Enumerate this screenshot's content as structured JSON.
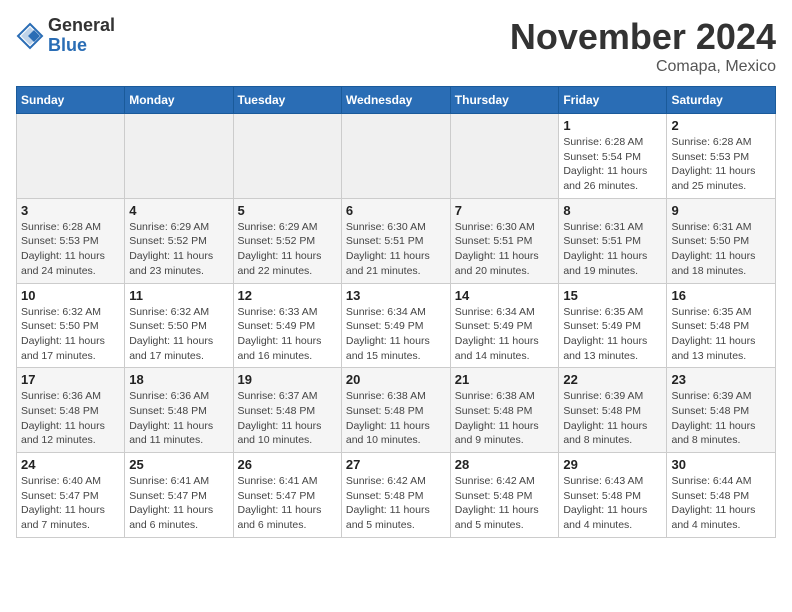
{
  "header": {
    "logo": {
      "line1": "General",
      "line2": "Blue"
    },
    "title": "November 2024",
    "location": "Comapa, Mexico"
  },
  "weekdays": [
    "Sunday",
    "Monday",
    "Tuesday",
    "Wednesday",
    "Thursday",
    "Friday",
    "Saturday"
  ],
  "weeks": [
    [
      {
        "day": "",
        "info": ""
      },
      {
        "day": "",
        "info": ""
      },
      {
        "day": "",
        "info": ""
      },
      {
        "day": "",
        "info": ""
      },
      {
        "day": "",
        "info": ""
      },
      {
        "day": "1",
        "info": "Sunrise: 6:28 AM\nSunset: 5:54 PM\nDaylight: 11 hours\nand 26 minutes."
      },
      {
        "day": "2",
        "info": "Sunrise: 6:28 AM\nSunset: 5:53 PM\nDaylight: 11 hours\nand 25 minutes."
      }
    ],
    [
      {
        "day": "3",
        "info": "Sunrise: 6:28 AM\nSunset: 5:53 PM\nDaylight: 11 hours\nand 24 minutes."
      },
      {
        "day": "4",
        "info": "Sunrise: 6:29 AM\nSunset: 5:52 PM\nDaylight: 11 hours\nand 23 minutes."
      },
      {
        "day": "5",
        "info": "Sunrise: 6:29 AM\nSunset: 5:52 PM\nDaylight: 11 hours\nand 22 minutes."
      },
      {
        "day": "6",
        "info": "Sunrise: 6:30 AM\nSunset: 5:51 PM\nDaylight: 11 hours\nand 21 minutes."
      },
      {
        "day": "7",
        "info": "Sunrise: 6:30 AM\nSunset: 5:51 PM\nDaylight: 11 hours\nand 20 minutes."
      },
      {
        "day": "8",
        "info": "Sunrise: 6:31 AM\nSunset: 5:51 PM\nDaylight: 11 hours\nand 19 minutes."
      },
      {
        "day": "9",
        "info": "Sunrise: 6:31 AM\nSunset: 5:50 PM\nDaylight: 11 hours\nand 18 minutes."
      }
    ],
    [
      {
        "day": "10",
        "info": "Sunrise: 6:32 AM\nSunset: 5:50 PM\nDaylight: 11 hours\nand 17 minutes."
      },
      {
        "day": "11",
        "info": "Sunrise: 6:32 AM\nSunset: 5:50 PM\nDaylight: 11 hours\nand 17 minutes."
      },
      {
        "day": "12",
        "info": "Sunrise: 6:33 AM\nSunset: 5:49 PM\nDaylight: 11 hours\nand 16 minutes."
      },
      {
        "day": "13",
        "info": "Sunrise: 6:34 AM\nSunset: 5:49 PM\nDaylight: 11 hours\nand 15 minutes."
      },
      {
        "day": "14",
        "info": "Sunrise: 6:34 AM\nSunset: 5:49 PM\nDaylight: 11 hours\nand 14 minutes."
      },
      {
        "day": "15",
        "info": "Sunrise: 6:35 AM\nSunset: 5:49 PM\nDaylight: 11 hours\nand 13 minutes."
      },
      {
        "day": "16",
        "info": "Sunrise: 6:35 AM\nSunset: 5:48 PM\nDaylight: 11 hours\nand 13 minutes."
      }
    ],
    [
      {
        "day": "17",
        "info": "Sunrise: 6:36 AM\nSunset: 5:48 PM\nDaylight: 11 hours\nand 12 minutes."
      },
      {
        "day": "18",
        "info": "Sunrise: 6:36 AM\nSunset: 5:48 PM\nDaylight: 11 hours\nand 11 minutes."
      },
      {
        "day": "19",
        "info": "Sunrise: 6:37 AM\nSunset: 5:48 PM\nDaylight: 11 hours\nand 10 minutes."
      },
      {
        "day": "20",
        "info": "Sunrise: 6:38 AM\nSunset: 5:48 PM\nDaylight: 11 hours\nand 10 minutes."
      },
      {
        "day": "21",
        "info": "Sunrise: 6:38 AM\nSunset: 5:48 PM\nDaylight: 11 hours\nand 9 minutes."
      },
      {
        "day": "22",
        "info": "Sunrise: 6:39 AM\nSunset: 5:48 PM\nDaylight: 11 hours\nand 8 minutes."
      },
      {
        "day": "23",
        "info": "Sunrise: 6:39 AM\nSunset: 5:48 PM\nDaylight: 11 hours\nand 8 minutes."
      }
    ],
    [
      {
        "day": "24",
        "info": "Sunrise: 6:40 AM\nSunset: 5:47 PM\nDaylight: 11 hours\nand 7 minutes."
      },
      {
        "day": "25",
        "info": "Sunrise: 6:41 AM\nSunset: 5:47 PM\nDaylight: 11 hours\nand 6 minutes."
      },
      {
        "day": "26",
        "info": "Sunrise: 6:41 AM\nSunset: 5:47 PM\nDaylight: 11 hours\nand 6 minutes."
      },
      {
        "day": "27",
        "info": "Sunrise: 6:42 AM\nSunset: 5:48 PM\nDaylight: 11 hours\nand 5 minutes."
      },
      {
        "day": "28",
        "info": "Sunrise: 6:42 AM\nSunset: 5:48 PM\nDaylight: 11 hours\nand 5 minutes."
      },
      {
        "day": "29",
        "info": "Sunrise: 6:43 AM\nSunset: 5:48 PM\nDaylight: 11 hours\nand 4 minutes."
      },
      {
        "day": "30",
        "info": "Sunrise: 6:44 AM\nSunset: 5:48 PM\nDaylight: 11 hours\nand 4 minutes."
      }
    ]
  ]
}
